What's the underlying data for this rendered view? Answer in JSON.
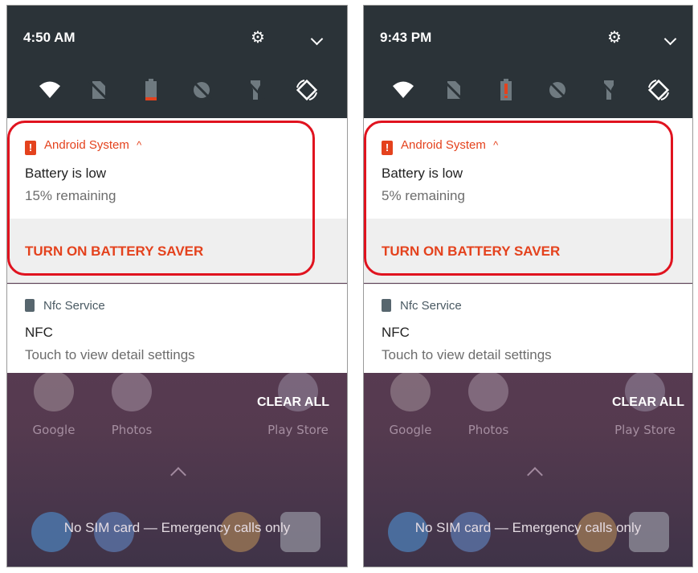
{
  "panels": [
    {
      "time": "4:50 AM",
      "notification": {
        "app_name": "Android System",
        "expand_glyph": "^",
        "title": "Battery is low",
        "subtitle": "15% remaining",
        "action": "TURN ON BATTERY SAVER"
      },
      "nfc": {
        "app_name": "Nfc Service",
        "title": "NFC",
        "subtitle": "Touch to view detail settings"
      },
      "clear_all": "CLEAR ALL",
      "apps": [
        "Google",
        "Photos",
        "Play Store"
      ],
      "sim_status": "No SIM card — Emergency calls only",
      "battery_level": 0.15
    },
    {
      "time": "9:43 PM",
      "notification": {
        "app_name": "Android System",
        "expand_glyph": "^",
        "title": "Battery is low",
        "subtitle": "5% remaining",
        "action": "TURN ON BATTERY SAVER"
      },
      "nfc": {
        "app_name": "Nfc Service",
        "title": "NFC",
        "subtitle": "Touch to view detail settings"
      },
      "clear_all": "CLEAR ALL",
      "apps": [
        "Google",
        "Photos",
        "Play Store"
      ],
      "sim_status": "No SIM card — Emergency calls only",
      "battery_level": 0.05
    }
  ],
  "colors": {
    "accent": "#e4421d",
    "highlight": "#e0131f",
    "quick_settings_bg": "#2b3338"
  },
  "icons": [
    "gear-icon",
    "chevron-down-icon",
    "wifi-icon",
    "no-sim-icon",
    "battery-icon",
    "data-saver-icon",
    "flashlight-icon",
    "auto-rotate-icon",
    "alert-icon",
    "nfc-doc-icon",
    "chevron-up-icon"
  ]
}
